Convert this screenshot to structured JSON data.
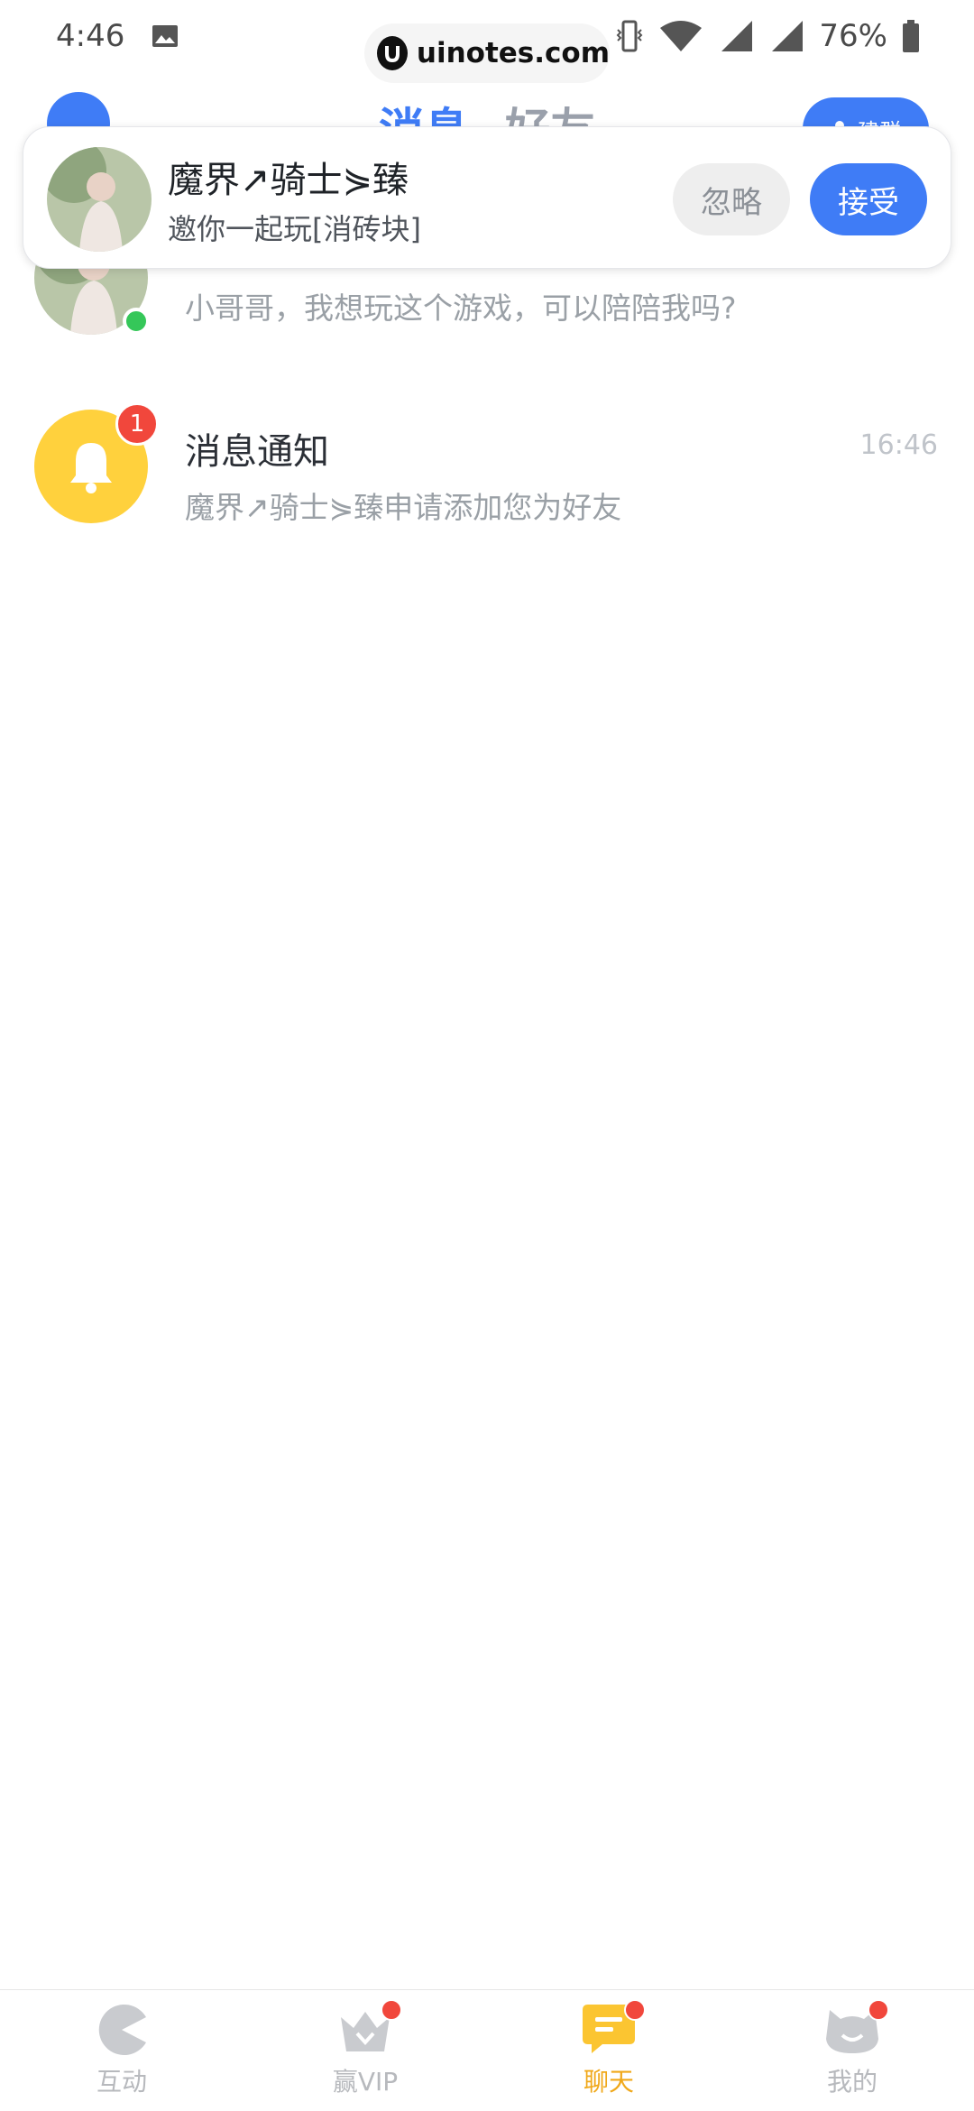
{
  "status_bar": {
    "time": "4:46",
    "battery": "76%",
    "watermark": "uinotes.com"
  },
  "header": {
    "tabs": [
      {
        "label": "消息"
      },
      {
        "label": "好友"
      }
    ],
    "create_group_label": "建群"
  },
  "invite": {
    "name": "魔界↗骑士⋟臻",
    "message": "邀你一起玩[消砖块]",
    "ignore_label": "忽略",
    "accept_label": "接受"
  },
  "conversations": [
    {
      "title": "",
      "preview": "小哥哥，我想玩这个游戏，可以陪陪我吗?",
      "online": true
    },
    {
      "title": "消息通知",
      "preview": "魔界↗骑士⋟臻申请添加您为好友",
      "time": "16:46",
      "badge": "1"
    }
  ],
  "bottom_nav": {
    "items": [
      {
        "label": "互动"
      },
      {
        "label": "赢VIP"
      },
      {
        "label": "聊天"
      },
      {
        "label": "我的"
      }
    ]
  },
  "colors": {
    "primary": "#3f7cf6",
    "accent": "#f0a81a",
    "badge": "#f1473c",
    "bell": "#ffd13d",
    "online": "#35c759"
  }
}
